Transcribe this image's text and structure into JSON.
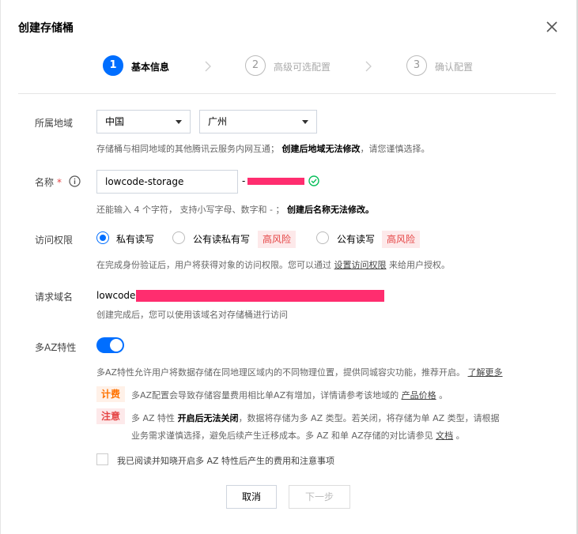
{
  "dialog": {
    "title": "创建存储桶"
  },
  "steps": [
    {
      "num": "1",
      "label": "基本信息"
    },
    {
      "num": "2",
      "label": "高级可选配置"
    },
    {
      "num": "3",
      "label": "确认配置"
    }
  ],
  "region": {
    "label": "所属地域",
    "country": "中国",
    "city": "广州",
    "hint_a": "存储桶与相同地域的其他腾讯云服务内网互通；",
    "hint_b": "创建后地域无法修改",
    "hint_c": "，请您谨慎选择。"
  },
  "name": {
    "label": "名称",
    "required": "*",
    "value": "lowcode-storage",
    "suffix": "-",
    "hint_a": "还能输入 4 个字符，  支持小写字母、数字和 - ；",
    "hint_b": "创建后名称无法修改。"
  },
  "access": {
    "label": "访问权限",
    "options": [
      "私有读写",
      "公有读私有写",
      "公有读写"
    ],
    "risk_tag": "高风险",
    "hint_a": "在完成身份验证后，用户将获得对象的访问权限。您可以通过",
    "hint_link": "设置访问权限",
    "hint_b": "来给用户授权。"
  },
  "domain": {
    "label": "请求域名",
    "prefix": "lowcode-",
    "hint": "创建完成后，您可以使用该域名对存储桶进行访问"
  },
  "multi_az": {
    "label": "多AZ特性",
    "enabled": true,
    "desc": "多AZ特性允许用户将数据存储在同地理区域内的不同物理位置，提供同城容灾功能，推荐开启。",
    "desc_link": "了解更多",
    "fee_tag": "计费",
    "fee_a": "多AZ配置会导致存储容量费用相比单AZ有增加，详情请参考该地域的",
    "fee_link": "产品价格",
    "fee_b": "。",
    "note_tag": "注意",
    "note_a": "多 AZ 特性",
    "note_b": "开启后无法关闭",
    "note_c": "，数据将存储为多 AZ 类型。若关闭，将存储为单 AZ 类型，请根据",
    "note_d": "业务需求谨慎选择，避免后续产生迁移成本。多 AZ 和单 AZ存储的对比请参见",
    "note_link": "文档",
    "note_e": "。",
    "agree": "我已阅读并知晓开启多 AZ 特性后产生的费用和注意事项"
  },
  "buttons": {
    "cancel": "取消",
    "next": "下一步"
  },
  "colors": {
    "primary": "#006eff",
    "danger": "#e54545",
    "warning": "#ff7200",
    "redaction": "#ff2d6f"
  }
}
